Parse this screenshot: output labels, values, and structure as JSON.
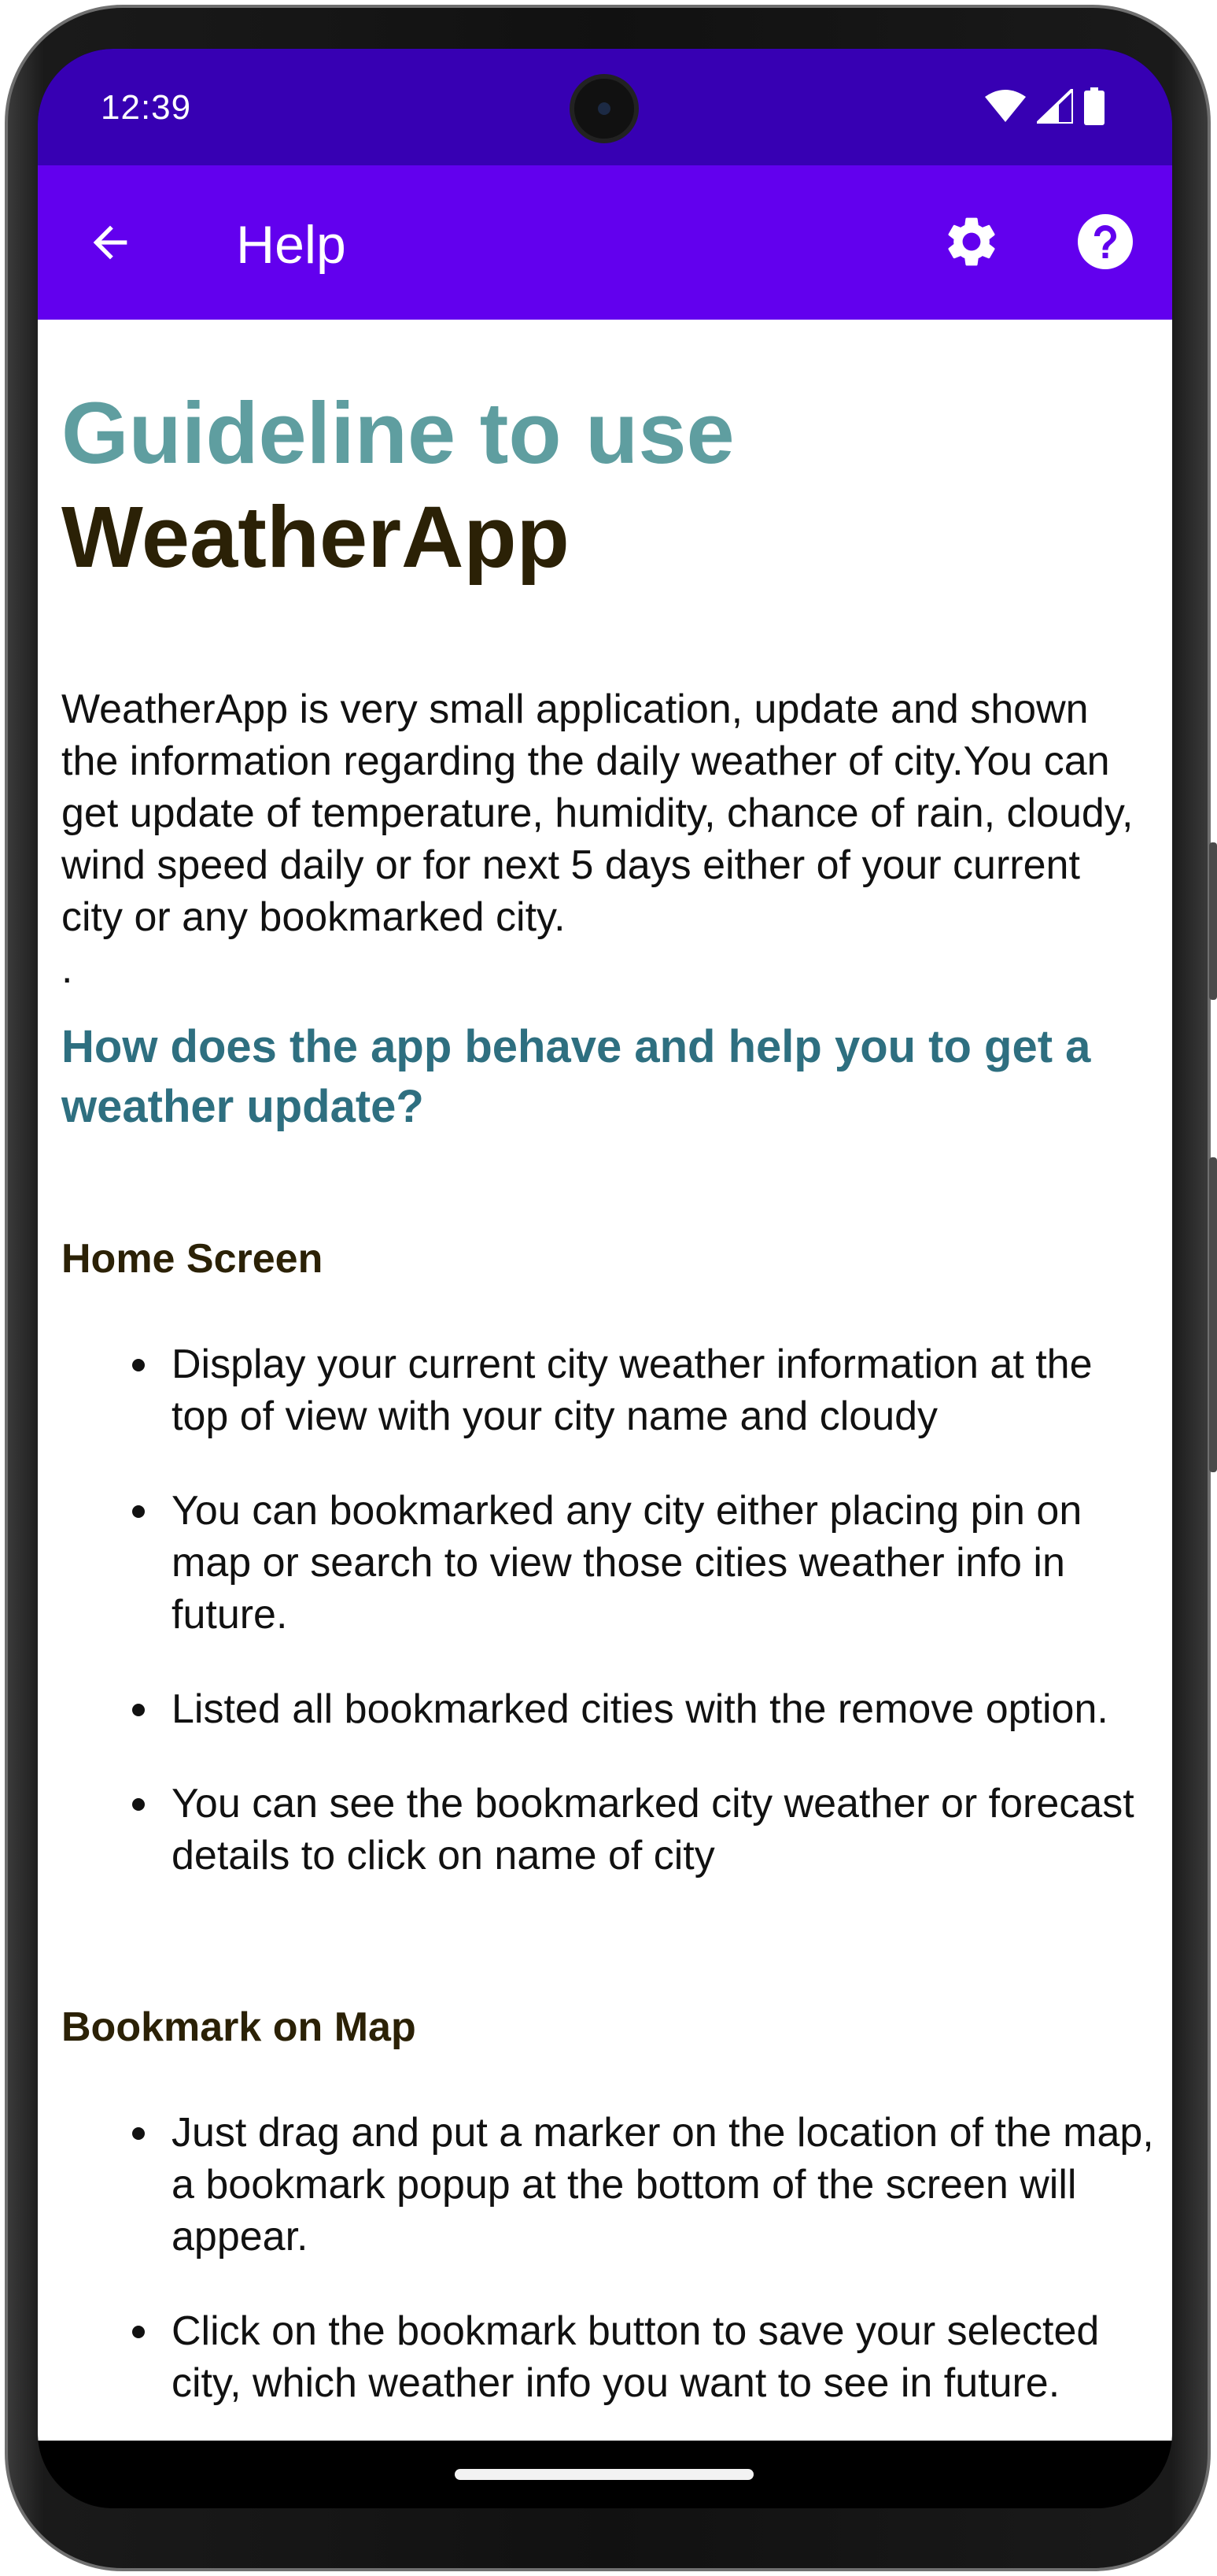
{
  "status_bar": {
    "time": "12:39",
    "icons": [
      "wifi-icon",
      "cell-signal-icon",
      "battery-icon"
    ]
  },
  "app_bar": {
    "title": "Help",
    "back_icon": "arrow-back-icon",
    "settings_icon": "gear-icon",
    "help_icon": "help-circle-icon",
    "color": "#6200ee",
    "status_color": "#3700b3"
  },
  "content": {
    "title_line1": "Guideline to use",
    "title_line2": "WeatherApp",
    "intro": "WeatherApp is very small application, update and shown the information regarding the daily weather of city.You can get update of temperature, humidity, chance of rain, cloudy, wind speed daily or for next 5 days either of your current city or any bookmarked city.",
    "intro_trailing": ".",
    "question": "How does the app behave and help you to get a weather update?",
    "sections": [
      {
        "heading": "Home Screen",
        "bullets": [
          "Display your current city weather information at the top of view with your city name and cloudy",
          "You can bookmarked any city either placing pin on map or search to view those cities weather info in future.",
          "Listed all bookmarked cities with the remove option.",
          "You can see the bookmarked city weather or forecast details to click on name of city"
        ]
      },
      {
        "heading": "Bookmark on Map",
        "bullets": [
          "Just drag and put a marker on the location of the map, a bookmark popup at the bottom of the screen will appear.",
          "Click on the bookmark button to save your selected city, which weather info you want to see in future."
        ]
      }
    ],
    "colors": {
      "title_accent": "#5f9ea0",
      "title_dark": "#2b2106",
      "question": "#2e6f80"
    }
  }
}
